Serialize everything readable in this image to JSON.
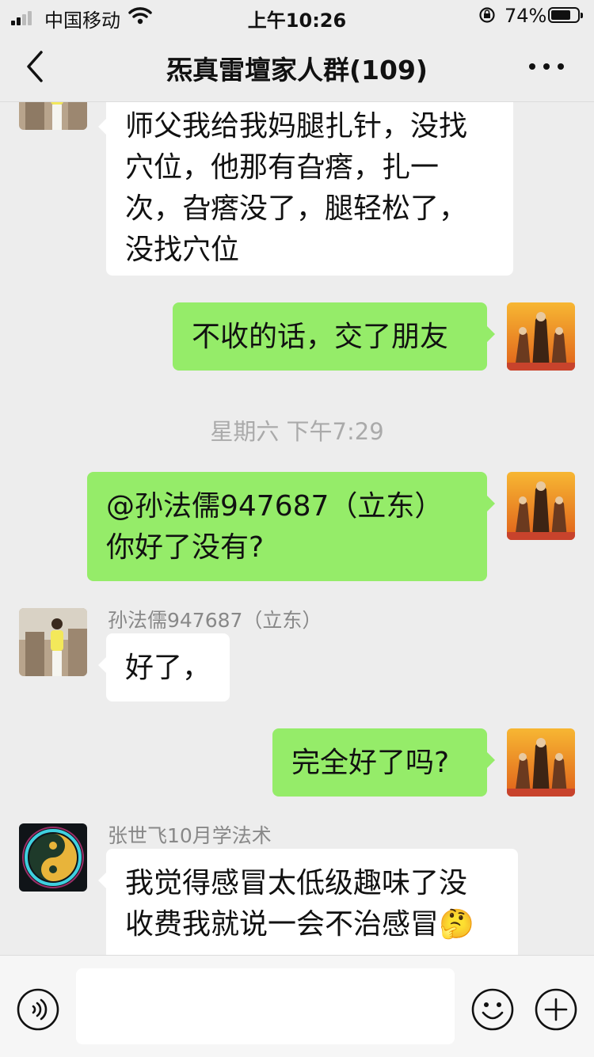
{
  "status_bar": {
    "carrier": "中国移动",
    "time": "上午10:26",
    "battery_pct": "74%",
    "battery_level": 0.74
  },
  "nav": {
    "title": "炁真雷壇家人群(109)"
  },
  "messages": [
    {
      "dir": "in",
      "sender": "",
      "text": "师父我给我妈腿扎针，没找\n穴位，他那有旮瘩，扎一\n次，旮瘩没了，腿轻松了，\n没找穴位",
      "avatar": "person-photo-avatar"
    },
    {
      "dir": "out",
      "text": "不收的话，交了朋友",
      "avatar": "deity-statue-avatar"
    },
    {
      "timestamp": "星期六 下午7:29"
    },
    {
      "dir": "out",
      "text": "@孙法儒947687（立东）\n你好了没有?",
      "avatar": "deity-statue-avatar"
    },
    {
      "dir": "in",
      "sender": "孙法儒947687（立东）",
      "text": "好了，",
      "avatar": "person-photo-avatar"
    },
    {
      "dir": "out",
      "text": "完全好了吗?",
      "avatar": "deity-statue-avatar"
    },
    {
      "dir": "in",
      "sender": "张世飞10月学法术",
      "text": "我觉得感冒太低级趣味了没\n收费我就说一会不治感冒🤔",
      "avatar": "yin-yang-avatar"
    }
  ],
  "input": {
    "placeholder": ""
  },
  "colors": {
    "outgoing_bubble": "#95ec69",
    "incoming_bubble": "#ffffff",
    "background": "#ededed"
  }
}
